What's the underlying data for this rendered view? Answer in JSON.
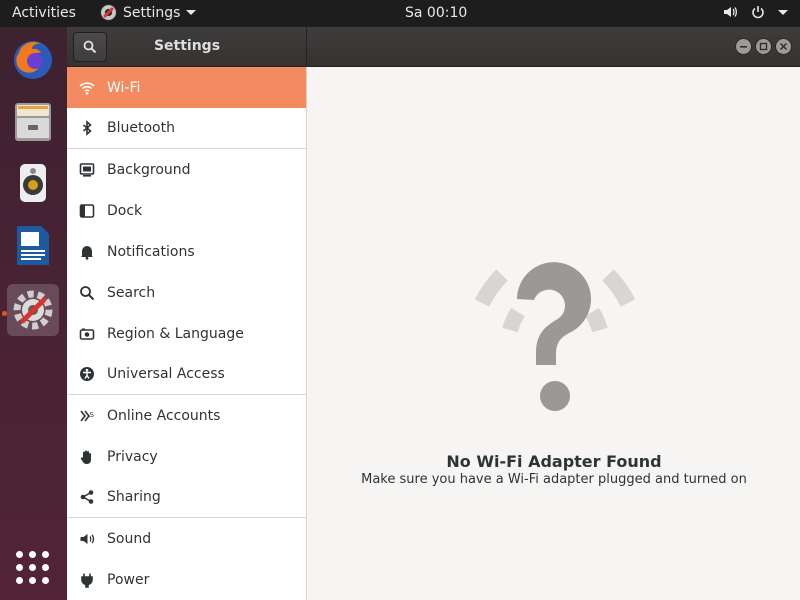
{
  "topbar": {
    "activities": "Activities",
    "app_name": "Settings",
    "clock": "Sa 00:10"
  },
  "dock": {
    "items": [
      {
        "name": "firefox",
        "icon": "firefox-icon"
      },
      {
        "name": "files",
        "icon": "file-cabinet-icon"
      },
      {
        "name": "rhythmbox",
        "icon": "speaker-icon"
      },
      {
        "name": "writer",
        "icon": "document-icon"
      },
      {
        "name": "settings",
        "icon": "settings-icon",
        "active": true
      }
    ],
    "show_apps_icon": "grid-icon"
  },
  "window": {
    "title": "Settings"
  },
  "sidebar": {
    "items": [
      {
        "label": "Wi-Fi",
        "icon": "wifi-icon",
        "selected": true
      },
      {
        "label": "Bluetooth",
        "icon": "bluetooth-icon"
      },
      {
        "label": "Background",
        "icon": "monitor-icon"
      },
      {
        "label": "Dock",
        "icon": "dock-icon"
      },
      {
        "label": "Notifications",
        "icon": "bell-icon"
      },
      {
        "label": "Search",
        "icon": "search-icon"
      },
      {
        "label": "Region & Language",
        "icon": "camera-icon"
      },
      {
        "label": "Universal Access",
        "icon": "accessibility-icon"
      },
      {
        "label": "Online Accounts",
        "icon": "online-accounts-icon"
      },
      {
        "label": "Privacy",
        "icon": "hand-icon"
      },
      {
        "label": "Sharing",
        "icon": "share-icon"
      },
      {
        "label": "Sound",
        "icon": "speaker-icon"
      },
      {
        "label": "Power",
        "icon": "plug-icon"
      }
    ]
  },
  "main": {
    "empty_title": "No Wi-Fi Adapter Found",
    "empty_subtitle": "Make sure you have a Wi-Fi adapter plugged and turned on"
  },
  "colors": {
    "accent": "#f48a5f",
    "topbar": "#1d1d1d",
    "dock": "#4b2335"
  }
}
